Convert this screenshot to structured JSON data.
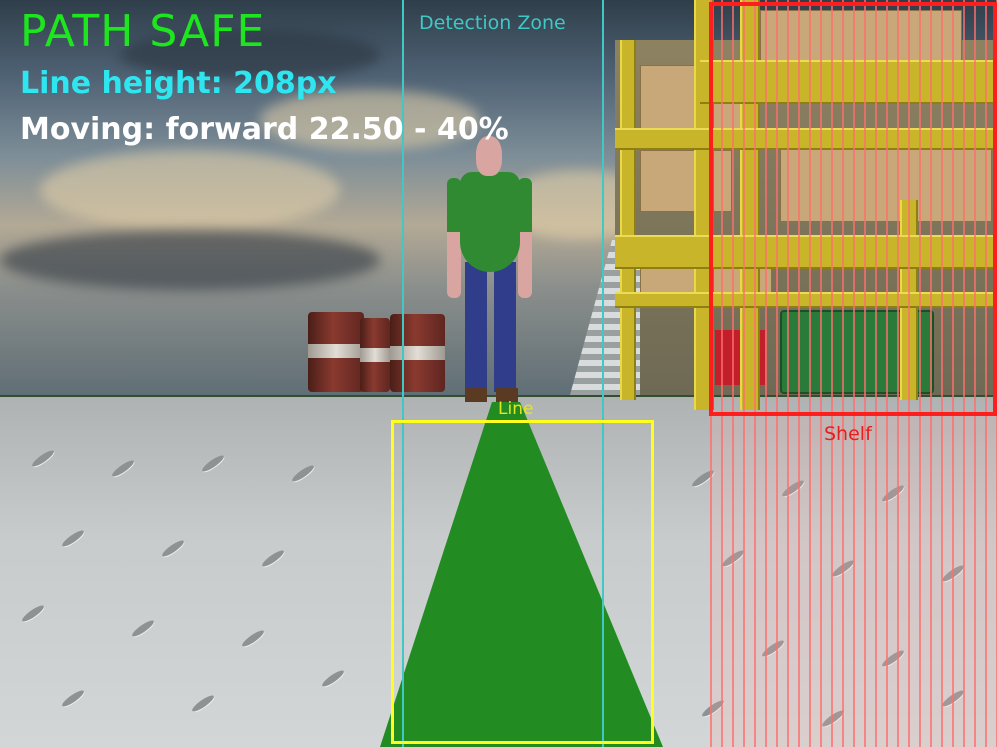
{
  "hud": {
    "status": "PATH SAFE",
    "line_height": "Line height: 208px",
    "moving": "Moving: forward 22.50 - 40%"
  },
  "overlays": {
    "detection_zone_label": "Detection Zone",
    "line_label": "Line",
    "shelf_label": "Shelf"
  },
  "colors": {
    "status_ok": "#1ee61e",
    "line_height_text": "#2ee6f0",
    "detection_zone": "#3fc8c4",
    "line_box": "#ffff1e",
    "shelf_box": "#ff1e1e",
    "path_fill": "#228b22"
  }
}
